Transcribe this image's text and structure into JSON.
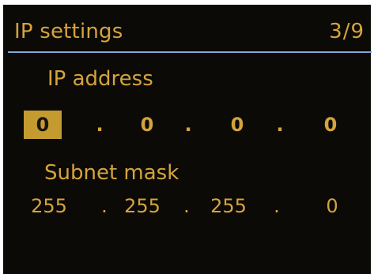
{
  "header": {
    "title": "IP settings",
    "page_indicator": "3/9"
  },
  "ip_address": {
    "label": "IP address",
    "octets": [
      "0",
      "0",
      "0",
      "0"
    ],
    "separator": ".",
    "selected_octet_index": 0
  },
  "subnet_mask": {
    "label": "Subnet mask",
    "octets": [
      "255",
      "255",
      "255",
      "0"
    ],
    "separator": "."
  },
  "colors": {
    "background": "#0c0a07",
    "text": "#d4a43c",
    "selection": "#c49b2f",
    "header_rule": "#7fa7d9"
  }
}
